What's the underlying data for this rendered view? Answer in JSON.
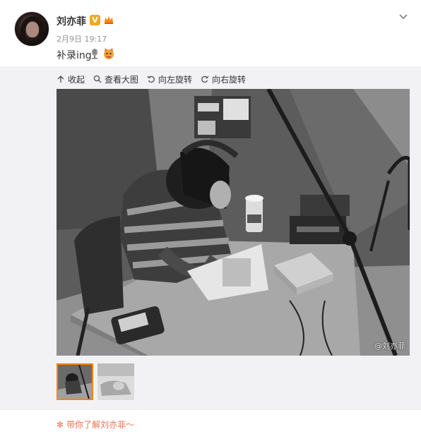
{
  "post": {
    "author": "刘亦菲",
    "verified_badge": "V",
    "timestamp": "2月9日 19:17",
    "text": "补录ing",
    "emojis": [
      "microphone-icon",
      "cat-emoji-icon"
    ]
  },
  "toolbar": {
    "collapse_label": "收起",
    "view_large_label": "查看大图",
    "rotate_left_label": "向左旋转",
    "rotate_right_label": "向右旋转"
  },
  "photo": {
    "watermark": "@刘亦菲"
  },
  "thumbnails": {
    "count": 2,
    "selected_index": 0
  },
  "footer": {
    "promo_text": "带你了解刘亦菲～"
  },
  "colors": {
    "accent": "#ff8200",
    "link": "#eb7350",
    "muted": "#939393",
    "badge": "#f5a623"
  }
}
